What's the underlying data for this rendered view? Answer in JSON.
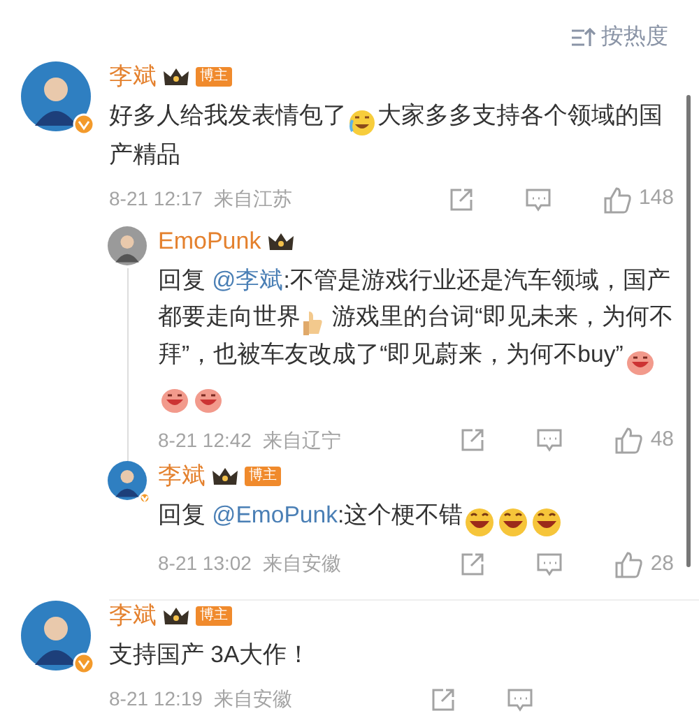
{
  "sort": {
    "label": "按热度"
  },
  "comments": [
    {
      "name": "李斌",
      "badge": "博主",
      "verified": true,
      "text": [
        {
          "kind": "text",
          "value": "好多人给我发表情包了"
        },
        {
          "kind": "cry"
        },
        {
          "kind": "text",
          "value": "大家多多支持各个领域的国产精品"
        }
      ],
      "time": "8-21 12:17",
      "location": "来自江苏",
      "likes": "148",
      "replies": [
        {
          "name": "EmoPunk",
          "verified": false,
          "text": [
            {
              "kind": "text",
              "value": "回复 "
            },
            {
              "kind": "mention",
              "value": "@李斌"
            },
            {
              "kind": "text",
              "value": ":不管是游戏行业还是汽车领域，国产都要走向世界"
            },
            {
              "kind": "thumb"
            },
            {
              "kind": "text",
              "value": " 游戏里的台词“即见未来，为何不拜”，也被车友改成了“即见蔚来，为何不buy”"
            },
            {
              "kind": "pig"
            },
            {
              "kind": "pig"
            },
            {
              "kind": "pig"
            }
          ],
          "time": "8-21 12:42",
          "location": "来自辽宁",
          "likes": "48"
        },
        {
          "name": "李斌",
          "badge": "博主",
          "verified": true,
          "text": [
            {
              "kind": "text",
              "value": "回复 "
            },
            {
              "kind": "mention",
              "value": "@EmoPunk"
            },
            {
              "kind": "text",
              "value": ":这个梗不错"
            },
            {
              "kind": "grin"
            },
            {
              "kind": "grin"
            },
            {
              "kind": "grin"
            }
          ],
          "time": "8-21 13:02",
          "location": "来自安徽",
          "likes": "28"
        }
      ]
    },
    {
      "name": "李斌",
      "badge": "博主",
      "verified": true,
      "text": [
        {
          "kind": "text",
          "value": "支持国产 3A大作！"
        }
      ],
      "time": "8-21 12:19",
      "location": "来自安徽"
    }
  ]
}
